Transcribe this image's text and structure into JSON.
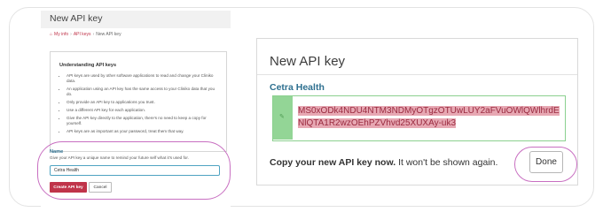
{
  "left_form": {
    "title": "New API key",
    "breadcrumb": {
      "home": "My info",
      "sep1": "›",
      "section": "API keys",
      "sep2": "›",
      "current": "New API key"
    },
    "info": {
      "title": "Understanding API keys",
      "items": [
        "API keys are used by other software applications to read and change your Cliniko data.",
        "An application using an API key has the same access to your Cliniko data that you do.",
        "Only provide an API key to applications you trust.",
        "Use a different API key for each application.",
        "Give the API key directly to the application, there's no need to keep a copy for yourself.",
        "API keys are as important as your password, treat them that way."
      ]
    },
    "name_field": {
      "label": "Name",
      "help": "Give your API key a unique name to remind your future self what it's used for.",
      "value": "Cetra Health"
    },
    "create_label": "Create API key",
    "cancel_label": "Cancel"
  },
  "dialog": {
    "title": "New API key",
    "company": "Cetra Health",
    "key_icon": "key-icon",
    "api_key": "MS0xODk4NDU4NTM3NDMyOTgzOTUwLUY2aFVuOWlQWlhrdENlQTA1R2wzOEhPZVhvd25XUXAy-uk3",
    "copy_bold": "Copy your new API key now.",
    "copy_rest": " It won't be shown again.",
    "done_label": "Done"
  },
  "colors": {
    "brand_red": "#c0344a",
    "link_blue": "#2d6f8f",
    "highlight_ring": "#c86fc1",
    "success_green": "#93d596"
  }
}
